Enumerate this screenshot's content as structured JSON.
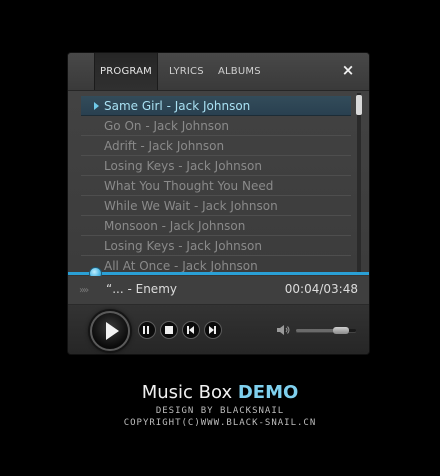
{
  "tabs": [
    {
      "label": "PROGRAM",
      "active": true
    },
    {
      "label": "LYRICS",
      "active": false
    },
    {
      "label": "ALBUMS",
      "active": false
    }
  ],
  "close_icon": "×",
  "playlist": [
    {
      "title": "Same Girl - Jack Johnson",
      "playing": true
    },
    {
      "title": "Go On - Jack Johnson",
      "playing": false
    },
    {
      "title": "Adrift - Jack Johnson",
      "playing": false
    },
    {
      "title": "Losing Keys - Jack Johnson",
      "playing": false
    },
    {
      "title": "What You Thought You Need",
      "playing": false
    },
    {
      "title": "While We Wait - Jack Johnson",
      "playing": false
    },
    {
      "title": "Monsoon - Jack Johnson",
      "playing": false
    },
    {
      "title": "Losing Keys - Jack Johnson",
      "playing": false
    },
    {
      "title": "All At Once - Jack Johnson",
      "playing": false
    }
  ],
  "now_playing": {
    "chevrons": "»»",
    "title": "“... - Enemy",
    "time": "00:04/03:48"
  },
  "progress_fraction": 0.02,
  "volume_fraction": 0.75,
  "brand": {
    "name": "Music Box",
    "tag": "DEMO"
  },
  "credits": [
    "DESIGN BY BLACKSNAIL",
    "COPYRIGHT(C)WWW.BLACK-SNAIL.CN"
  ],
  "colors": {
    "accent": "#2aa0d6",
    "active_row_text": "#a8e0f2",
    "demo": "#7fd0ee"
  },
  "icons": [
    "play-icon",
    "pause-icon",
    "stop-icon",
    "previous-icon",
    "next-icon",
    "volume-icon",
    "close-icon"
  ]
}
